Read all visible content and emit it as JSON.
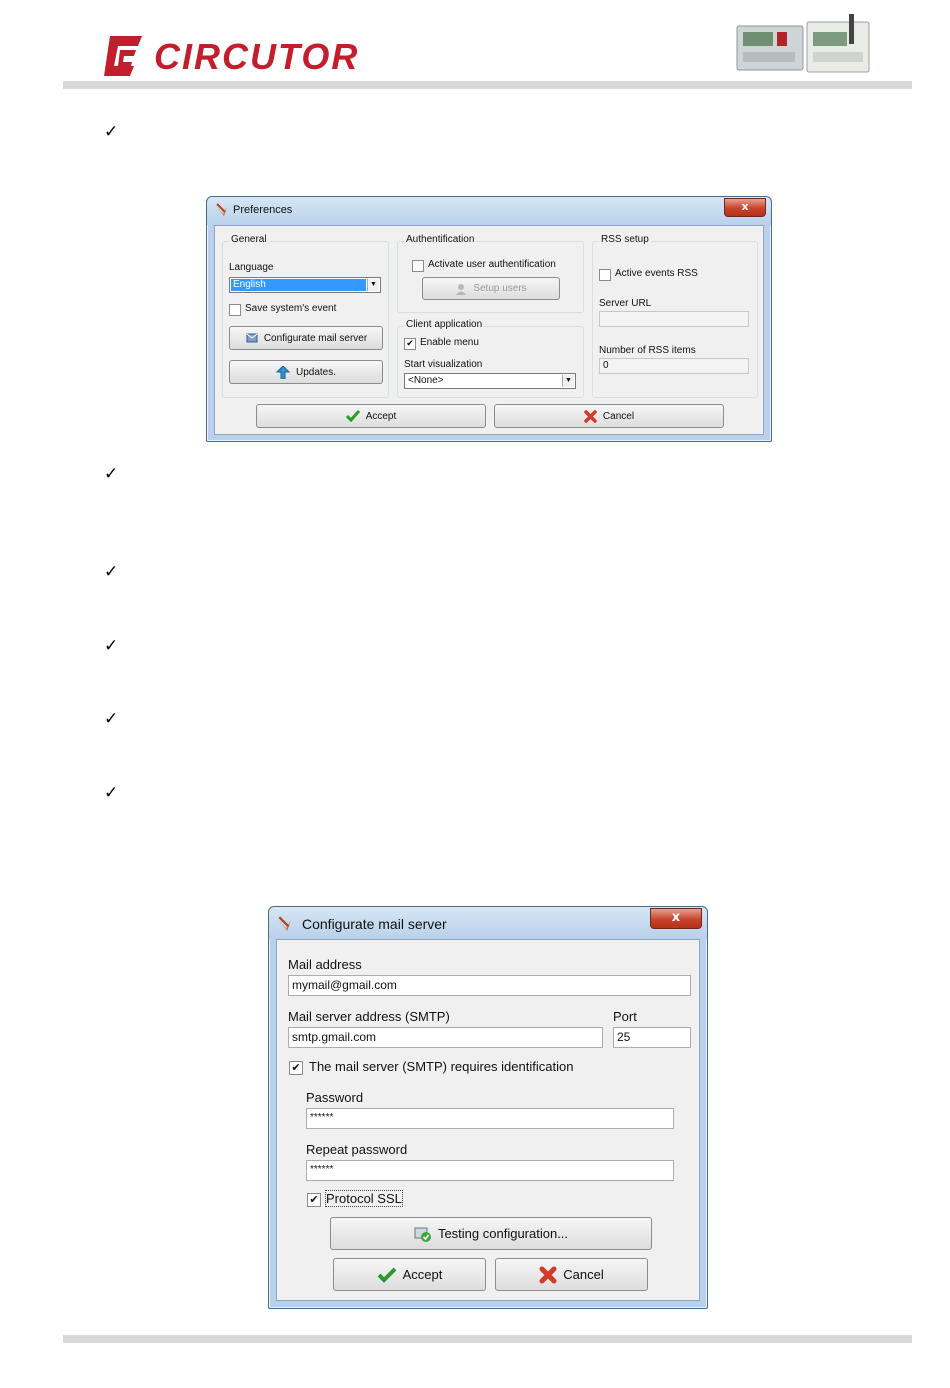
{
  "header": {
    "brand": "CIRCUTOR"
  },
  "bullets": [
    "✓",
    "✓",
    "✓",
    "✓",
    "✓",
    "✓"
  ],
  "preferences": {
    "title": "Preferences",
    "close": "x",
    "general": {
      "legend": "General",
      "language_label": "Language",
      "language_value": "English",
      "save_event_label": "Save system's event",
      "save_event_checked": false,
      "mail_button": "Configurate mail server",
      "updates_button": "Updates."
    },
    "authentication": {
      "legend": "Authentification",
      "activate_label": "Activate user authentification",
      "activate_checked": false,
      "setup_users_button": "Setup users"
    },
    "client": {
      "legend": "Client application",
      "enable_menu_label": "Enable menu",
      "enable_menu_checked": true,
      "start_label": "Start visualization",
      "start_value": "<None>"
    },
    "rss": {
      "legend": "RSS setup",
      "active_label": "Active events RSS",
      "active_checked": false,
      "server_url_label": "Server URL",
      "server_url_value": "",
      "items_label": "Number of RSS items",
      "items_value": "0"
    },
    "accept_button": "Accept",
    "cancel_button": "Cancel"
  },
  "mail_dialog": {
    "title": "Configurate mail server",
    "close": "x",
    "mail_address_label": "Mail address",
    "mail_address_value": "mymail@gmail.com",
    "smtp_label": "Mail server address (SMTP)",
    "smtp_value": "smtp.gmail.com",
    "port_label": "Port",
    "port_value": "25",
    "requires_id_label": "The mail server (SMTP) requires identification",
    "requires_id_checked": true,
    "password_label": "Password",
    "password_value": "******",
    "repeat_password_label": "Repeat password",
    "repeat_password_value": "******",
    "ssl_label": "Protocol SSL",
    "ssl_checked": true,
    "testing_button": "Testing configuration...",
    "accept_button": "Accept",
    "cancel_button": "Cancel"
  },
  "colors": {
    "brand_red": "#c41e2e",
    "rule_gray": "#d9d9d9",
    "window_frame": "#b9d1ea",
    "selection_blue": "#3399ff"
  }
}
